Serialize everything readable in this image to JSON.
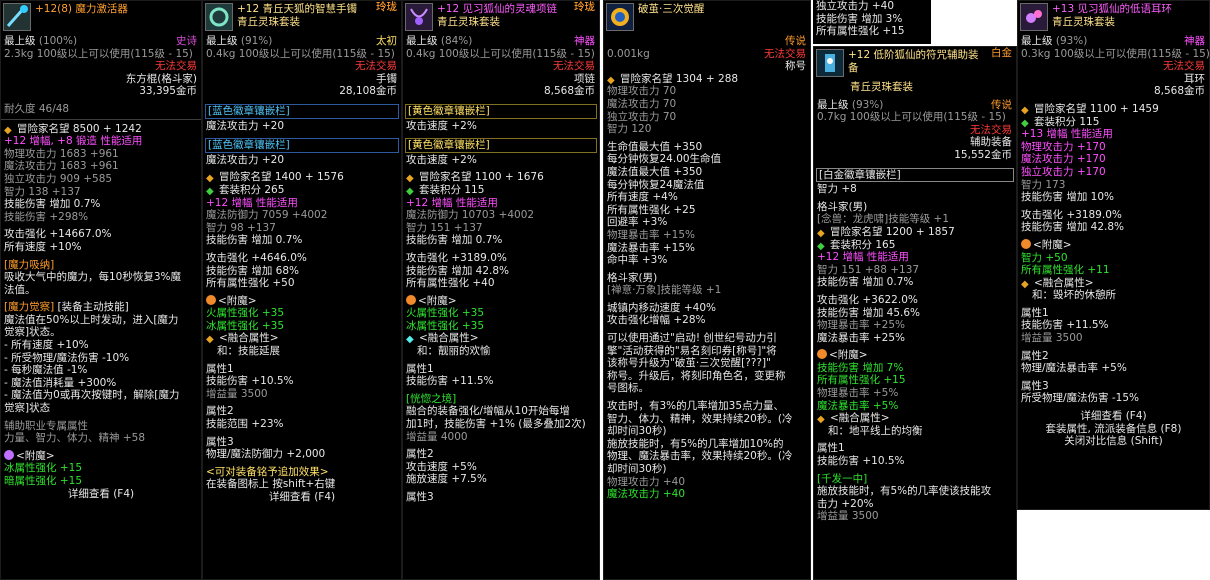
{
  "p1": {
    "title": "+12(8) 魔力激活器",
    "grade": "最上级",
    "grade_pct": "(100%)",
    "rarity": "史诗",
    "weight": "2.3kg",
    "req": "100级以上可以使用(115级 - 15)",
    "trade": "无法交易",
    "type": "东方棍(格斗家)",
    "price": "33,395金币",
    "dur": "耐久度 46/48",
    "fame": "冒险家名望 8500 + 1242",
    "amp": "+12 增幅, +8 锻造 性能适用",
    "s1": "物理攻击力 1683 +961",
    "s2": "魔法攻击力 1683 +961",
    "s3": "独立攻击力 909 +585",
    "s4": "智力 138 +137",
    "s5": "技能伤害 增加 0.7%",
    "s6": "技能伤害 +298%",
    "s7": "攻击强化 +14667.0%",
    "s8": "所有速度 +10%",
    "skill_a": "[魔力吸纳]",
    "skill_a_text": "吸收大气中的魔力，每10秒恢复3%魔",
    "skill_a_text2": "法值。",
    "skill_b": "[魔力觉察]",
    "skill_b_tag": "[装备主动技能]",
    "sb1": "魔法值在50%以上时发动，进入[魔力",
    "sb2": "觉察]状态。",
    "sb3": "- 所有速度 +10%",
    "sb4": "- 所受物理/魔法伤害 -10%",
    "sb5": "- 每秒魔法值 -1%",
    "sb6": "- 魔法值消耗量 +300%",
    "sb7": "- 魔法值为0或再次按键时，解除[魔力",
    "sb8": "觉察]状态",
    "aux": "辅助职业专属属性",
    "aux2": "力量、智力、体力、精神 +58",
    "ench": "<附魔>",
    "e1": "冰属性强化 +15",
    "e2": "暗属性强化 +15",
    "foot": "详细查看 (F4)"
  },
  "p2": {
    "title": "+12 青丘天狐的智慧手镯",
    "sub": "青丘灵珠套装",
    "grade": "最上级",
    "grade_pct": "(91%)",
    "rarity": "太初",
    "weight": "0.4kg",
    "req": "100级以上可以使用(115级 - 15)",
    "trade": "无法交易",
    "type": "手镯",
    "price": "28,108金币",
    "slot1": "[蓝色徽章镶嵌栏]",
    "slot1r": "玲珑",
    "slot1v": "魔法攻击力 +20",
    "slot2": "[蓝色徽章镶嵌栏]",
    "slot2r": "玲珑",
    "slot2v": "魔法攻击力 +20",
    "fame": "冒险家名望 1400 + 1576",
    "set": "套装积分 265",
    "amp": "+12 增幅 性能适用",
    "s1": "魔法防御力 7059 +4002",
    "s2": "智力 98 +137",
    "s3": "技能伤害 增加 0.7%",
    "s4": "攻击强化 +4646.0%",
    "s5": "技能伤害 增加 68%",
    "s6": "所有属性强化 +50",
    "ench": "<附魔>",
    "e1": "火属性强化 +35",
    "e2": "冰属性强化 +35",
    "fuse": "<融合属性>",
    "fuse2": "和：技能延展",
    "a1": "属性1",
    "a1a": "技能伤害 +10.5%",
    "a1b": "增益量 3500",
    "a2": "属性2",
    "a2a": "技能范围 +23%",
    "a3": "属性3",
    "a3a": "物理/魔法防御力 +2,000",
    "extra": "<可对装备铭予追加效果>",
    "extra2": "在装备图标上 按shift+右键",
    "foot": "详细查看 (F4)"
  },
  "p3": {
    "title": "+12 见习狐仙的灵魂项链",
    "sub": "青丘灵珠套装",
    "grade": "最上级",
    "grade_pct": "(84%)",
    "rarity": "神器",
    "weight": "0.4kg",
    "req": "100级以上可以使用(115级 - 15)",
    "trade": "无法交易",
    "type": "项链",
    "price": "8,568金币",
    "slot1": "[黄色徽章镶嵌栏]",
    "slot1r": "玲珑",
    "slot1v": "攻击速度 +2%",
    "slot2": "[黄色徽章镶嵌栏]",
    "slot2r": "玲珑",
    "slot2v": "攻击速度 +2%",
    "fame": "冒险家名望 1100 + 1676",
    "set": "套装积分 115",
    "amp": "+12 增幅 性能适用",
    "s1": "魔法防御力 10703 +4002",
    "s2": "智力 151 +137",
    "s3": "技能伤害 增加 0.7%",
    "s4": "攻击强化 +3189.0%",
    "s5": "技能伤害 增加 42.8%",
    "s6": "所有属性强化 +40",
    "ench": "<附魔>",
    "e1": "火属性强化 +35",
    "e2": "冰属性强化 +35",
    "fuse": "<融合属性>",
    "fuse2": "和：靓丽的欢愉",
    "a1": "属性1",
    "a1a": "技能伤害 +11.5%",
    "wish": "[恍惚之境]",
    "w1": "融合的装备强化/增幅从10开始每增",
    "w2": "加1时，技能伤害 +1% (最多叠加2次)",
    "w3": "增益量 4000",
    "a2": "属性2",
    "a2a": "攻击速度 +5%",
    "a2b": "施放速度 +7.5%",
    "a3": "属性3"
  },
  "p4": {
    "title": "破茧·三次觉醒",
    "grade_r": "传说",
    "trade": "无法交易",
    "weight": "0.001kg",
    "type": "称号",
    "fame": "冒险家名望 1304 + 288",
    "s1": "物理攻击力 70",
    "s2": "魔法攻击力 70",
    "s3": "独立攻击力 70",
    "s4": "智力 120",
    "s5": "生命值最大值 +350",
    "s6": "每分钟恢复24.00生命值",
    "s7": "魔法值最大值 +350",
    "s8": "每分钟恢复24魔法值",
    "s9": "所有速度 +4%",
    "s10": "所有属性强化 +25",
    "s11": "回避率 +3%",
    "s12": "物理暴击率 +15%",
    "s13": "魔法暴击率 +15%",
    "s14": "命中率 +3%",
    "job": "格斗家(男)",
    "job2": "[禅意·万象]技能等级 +1",
    "t1": "城镇内移动速度 +40%",
    "t2": "攻击强化增幅 +28%",
    "d1": "可以使用通过\"启动! 创世纪号动力引",
    "d2": "擎\"活动获得的\"易名刻印券[称号]\"将",
    "d3": "该称号升级为\"破茧·三次觉醒[???]\"",
    "d4": "称号。升级后，将刻印角色名，变更称",
    "d5": "号图标。",
    "f1": "攻击时，有3%的几率增加35点力量、",
    "f2": "智力、体力、精神，效果持续20秒。(冷",
    "f3": "却时间30秒)",
    "f4": "施放技能时，有5%的几率增加10%的",
    "f5": "物理、魔法暴击率，效果持续20秒。(冷",
    "f6": "却时间30秒)",
    "b1": "物理攻击力 +40",
    "b2": "魔法攻击力 +40"
  },
  "p5top": {
    "s1": "独立攻击力 +40",
    "s2": "技能伤害 增加 3%",
    "s3": "所有属性强化 +15"
  },
  "p5": {
    "title": "+12 低阶狐仙的符咒辅助装",
    "title2": "备",
    "sub": "青丘灵珠套装",
    "grade": "最上级",
    "grade_pct": "(93%)",
    "rarity": "传说",
    "weight": "0.7kg",
    "req": "100级以上可以使用(115级 - 15)",
    "trade": "无法交易",
    "type": "辅助装备",
    "price": "15,552金币",
    "slot1": "[白金徽章镶嵌栏]",
    "slot1r": "白金",
    "slot1v": "智力 +8",
    "job": "格斗家(男)",
    "job2": "[念兽：龙虎啸]技能等级 +1",
    "fame": "冒险家名望 1200 + 1857",
    "set": "套装积分 165",
    "amp": "+12 增幅 性能适用",
    "s1": "智力 151 +88 +137",
    "s2": "技能伤害 增加 0.7%",
    "s3": "攻击强化 +3622.0%",
    "s4": "技能伤害 增加 45.6%",
    "s5": "物理暴击率 +25%",
    "s6": "魔法暴击率 +25%",
    "ench": "<附魔>",
    "e1": "技能伤害 增加 7%",
    "e2": "所有属性强化 +15",
    "e3": "物理暴击率 +5%",
    "e4": "魔法暴击率 +5%",
    "fuse": "<融合属性>",
    "fuse2": "和：地平线上的均衡",
    "a1": "属性1",
    "a1a": "技能伤害 +10.5%",
    "k": "[千发一中]",
    "k1": "施放技能时，有5%的几率使该技能攻",
    "k2": "击力 +20%",
    "k3": "增益量 3500"
  },
  "p6": {
    "title": "+13 见习狐仙的低语耳环",
    "sub": "青丘灵珠套装",
    "grade": "最上级",
    "grade_pct": "(93%)",
    "rarity": "神器",
    "weight": "0.3kg",
    "req": "100级以上可以使用(115级 - 15)",
    "trade": "无法交易",
    "type": "耳环",
    "price": "8,568金币",
    "fame": "冒险家名望 1100 + 1459",
    "set": "套装积分 115",
    "amp": "+13 增幅 性能适用",
    "s1": "物理攻击力 +170",
    "s2": "魔法攻击力 +170",
    "s3": "独立攻击力 +170",
    "s4": "智力 173",
    "s5": "技能伤害 增加 10%",
    "s6": "攻击强化 +3189.0%",
    "s7": "技能伤害 增加 42.8%",
    "ench": "<附魔>",
    "e1": "智力 +50",
    "e2": "所有属性强化 +11",
    "fuse": "<融合属性>",
    "fuse2": "和：毁坏的休憩所",
    "a1": "属性1",
    "a1a": "技能伤害 +11.5%",
    "a1b": "增益量 3500",
    "a2": "属性2",
    "a2a": "物理/魔法暴击率 +5%",
    "a3": "属性3",
    "a3a": "所受物理/魔法伤害 -15%",
    "f1": "详细查看 (F4)",
    "f2": "套装属性, 流派装备信息 (F8)",
    "f3": "关闭对比信息 (Shift)"
  }
}
